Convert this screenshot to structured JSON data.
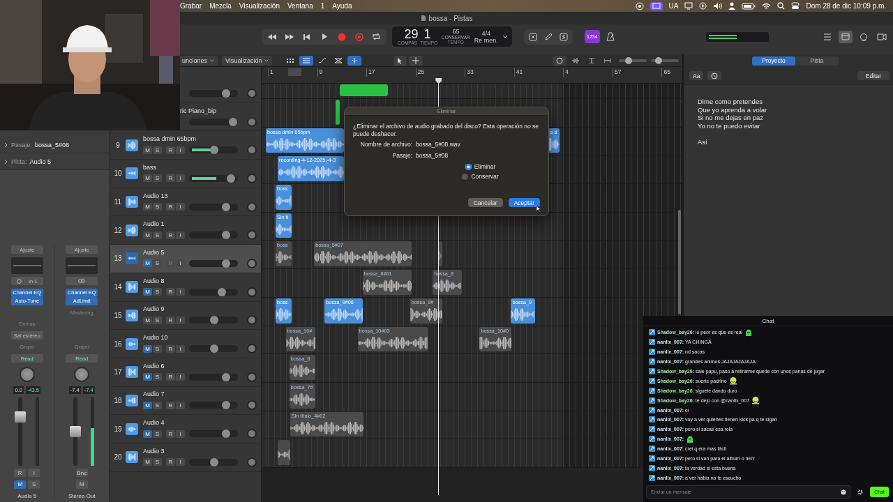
{
  "menu_bar": {
    "items": [
      "Grabar",
      "Mezcla",
      "Visualización",
      "Ventana",
      "1",
      "Ayuda"
    ],
    "input_source": "UA",
    "clock": "Dom 28 de dic 10:09 p.m."
  },
  "window": {
    "title": "bossa - Pistas"
  },
  "control_bar": {
    "bar": "29",
    "beat": "1",
    "bar_label": "COMPÁS",
    "beat_label": "TIEMPO",
    "tempo": "65",
    "tempo_mode": "CONSERVAR",
    "tempo_label": "TEMPO",
    "signature": "4/4",
    "key": "Re men.",
    "count_in": {
      "label": "1234",
      "on": true
    }
  },
  "toolbar": {
    "menus": [
      "unciones",
      "Visualización"
    ],
    "toggles": [
      {
        "kind": "grid",
        "on": false
      },
      {
        "kind": "list",
        "on": true
      },
      {
        "kind": "curve",
        "on": false
      },
      {
        "kind": "flex",
        "on": false
      },
      {
        "kind": "snap",
        "on": true
      }
    ],
    "zoom_sliders": [
      {
        "level": 0.3
      },
      {
        "level": 0.2
      }
    ]
  },
  "inspector": {
    "region": {
      "label": "Pasaje:",
      "value": "bossa_5#08"
    },
    "track": {
      "label": "Pista:",
      "value": "Audio 5"
    },
    "strips": [
      {
        "kind": "audio",
        "name": "Audio 5",
        "setting": "Ajuste",
        "input": "In 1",
        "plugins": [
          "Channel EQ",
          "Auto-Tune"
        ],
        "sends": "Envíos",
        "output": "Sal estéreo",
        "group": "Grupo",
        "automation": "Read",
        "volume": "0.0",
        "peak": "-43.5",
        "fader": {
          "level": 0.75
        },
        "arm": [
          "R",
          "I"
        ],
        "mute": "M",
        "solo": "S",
        "muted": true
      },
      {
        "kind": "output",
        "name": "Stereo Out",
        "setting": "Ajuste",
        "plugins": [
          "Channel EQ",
          "AdLimit"
        ],
        "plugin_set": "Mastering",
        "group": "Grupo",
        "automation": "Read",
        "volume": "-7.4",
        "peak": "-7.4",
        "fader": {
          "level": 0.5
        },
        "meter": {
          "level": 0.55
        },
        "bounce": "Bnc",
        "mute": "M",
        "muted": false
      }
    ]
  },
  "tracks": [
    {
      "level": 0.76,
      "selected": false,
      "regions": [
        {
          "kind": "midi"
        }
      ]
    },
    {
      "name": "ric Piano_bip",
      "level": 0.9,
      "selected": false,
      "regions": [
        {
          "kind": "midi"
        }
      ]
    },
    {
      "number": "9",
      "name": "bossa dmin 65bpm",
      "mute": "M",
      "solo": "S",
      "record": "R",
      "input": "I",
      "muted": false,
      "armed": false,
      "selected": false,
      "level": 0.51,
      "meter": {
        "level": 0.43
      },
      "regions": [
        {
          "kind": "audio",
          "name": "bossa dmin 65bpm",
          "muted": false,
          "selected": false
        },
        {
          "kind": "audio",
          "name": "a d",
          "muted": false,
          "selected": false
        }
      ]
    },
    {
      "number": "10",
      "name": "bass",
      "mute": "M",
      "solo": "S",
      "record": "R",
      "input": "I",
      "muted": false,
      "armed": false,
      "selected": false,
      "level": 0.86,
      "meter": {
        "level": 0.5
      },
      "regions": [
        {
          "kind": "audio",
          "name": "recording-4-12-2025,-4-3",
          "muted": false,
          "selected": false
        }
      ]
    },
    {
      "number": "11",
      "name": "Audio 13",
      "mute": "M",
      "solo": "S",
      "record": "R",
      "input": "I",
      "muted": false,
      "armed": false,
      "selected": false,
      "level": 0.76,
      "regions": [
        {
          "kind": "audio",
          "name": "boss",
          "muted": false,
          "selected": false
        }
      ]
    },
    {
      "number": "12",
      "name": "Audio 1",
      "mute": "M",
      "solo": "S",
      "record": "R",
      "input": "I",
      "muted": false,
      "armed": false,
      "selected": false,
      "level": 0.76,
      "regions": [
        {
          "kind": "audio",
          "name": "Sin tí",
          "muted": false,
          "selected": false
        }
      ]
    },
    {
      "number": "13",
      "name": "Audio 5",
      "mute": "M",
      "solo": "S",
      "record": "R",
      "input": "I",
      "muted": true,
      "armed": true,
      "selected": true,
      "level": 0.76,
      "regions": [
        {
          "kind": "audio",
          "name": "boss",
          "muted": true,
          "selected": false
        },
        {
          "kind": "audio",
          "name": "bossa_5#07",
          "muted": true,
          "selected": false
        },
        {
          "kind": "audio",
          "muted": true,
          "selected": true
        }
      ]
    },
    {
      "number": "14",
      "name": "Audio 8",
      "mute": "M",
      "solo": "S",
      "record": "R",
      "input": "I",
      "muted": true,
      "armed": false,
      "selected": false,
      "level": 0.67,
      "regions": [
        {
          "kind": "audio",
          "name": "bossa_8#01",
          "muted": true,
          "selected": false
        },
        {
          "kind": "audio",
          "name": "bossa_8",
          "muted": true,
          "selected": false
        }
      ]
    },
    {
      "number": "15",
      "name": "Audio 9",
      "mute": "M",
      "solo": "S",
      "record": "R",
      "input": "I",
      "muted": false,
      "armed": false,
      "selected": false,
      "level": 0.51,
      "regions": [
        {
          "kind": "audio",
          "name": "boss",
          "muted": false,
          "selected": false
        },
        {
          "kind": "audio",
          "name": "bossa_9#06",
          "muted": false,
          "selected": false
        },
        {
          "kind": "audio",
          "name": "bossa_9#",
          "muted": true,
          "selected": false
        },
        {
          "kind": "audio",
          "name": "bossa_9",
          "muted": false,
          "selected": false
        }
      ]
    },
    {
      "number": "16",
      "name": "Audio 10",
      "mute": "M",
      "solo": "S",
      "record": "R",
      "input": "I",
      "muted": true,
      "armed": false,
      "selected": false,
      "level": 0.51,
      "regions": [
        {
          "kind": "audio",
          "name": "bossa_10#",
          "muted": true,
          "selected": false
        },
        {
          "kind": "audio",
          "name": "bossa_10#03",
          "muted": true,
          "selected": false
        },
        {
          "kind": "audio",
          "name": "bossa_10#0",
          "muted": true,
          "selected": false
        }
      ]
    },
    {
      "number": "17",
      "name": "Audio 6",
      "mute": "M",
      "solo": "S",
      "record": "R",
      "input": "I",
      "muted": true,
      "armed": false,
      "selected": false,
      "level": 0.76,
      "regions": [
        {
          "kind": "audio",
          "name": "bossa_6",
          "muted": true,
          "selected": false
        }
      ]
    },
    {
      "number": "18",
      "name": "Audio 7",
      "mute": "M",
      "solo": "S",
      "record": "R",
      "input": "I",
      "muted": true,
      "armed": false,
      "selected": false,
      "level": 0.76,
      "regions": [
        {
          "kind": "audio",
          "name": "bossa_7#",
          "muted": true,
          "selected": false
        }
      ]
    },
    {
      "number": "19",
      "name": "Audio 4",
      "mute": "M",
      "solo": "S",
      "record": "R",
      "input": "I",
      "muted": true,
      "armed": false,
      "selected": false,
      "level": 0.76,
      "regions": [
        {
          "kind": "audio",
          "name": "Sin título_4#02",
          "muted": true,
          "selected": false
        }
      ]
    },
    {
      "number": "20",
      "name": "Audio 3",
      "mute": "M",
      "solo": "S",
      "record": "R",
      "input": "I",
      "muted": false,
      "armed": false,
      "selected": false,
      "level": 0.51,
      "regions": [
        {
          "kind": "audio",
          "muted": true,
          "selected": false
        }
      ]
    }
  ],
  "arrange": {
    "ruler": [
      "1",
      "9",
      "17",
      "25",
      "33",
      "41",
      "4",
      "57",
      "65"
    ]
  },
  "dialog": {
    "title": "Eliminar",
    "message": "¿Eliminar el archivo de audio grabado del disco? Esta operación no se puede deshacer.",
    "fields": [
      {
        "label": "Nombre de archivo:",
        "value": "bossa_5#08.wav"
      },
      {
        "label": "Pasaje:",
        "value": "bossa_5#08"
      }
    ],
    "options": [
      {
        "label": "Eliminar",
        "selected": true
      },
      {
        "label": "Conservar",
        "selected": false
      }
    ],
    "buttons": [
      {
        "label": "Cancelar",
        "kind": "secondary"
      },
      {
        "label": "Aceptar",
        "kind": "default"
      }
    ]
  },
  "notes": {
    "tabs": [
      {
        "label": "Proyecto",
        "selected": true
      },
      {
        "label": "Pista",
        "selected": false
      }
    ],
    "font_button": "Aa",
    "edit_button": "Editar",
    "stanzas": [
      [
        "Dime como pretendes",
        "Que yo aprenda a volar",
        "Si no me dejas en paz",
        "Yo no te puedo evitar"
      ],
      [
        "Así"
      ]
    ]
  },
  "chat": {
    "title": "Chat",
    "messages": [
      {
        "user": "Shadow_bay26:",
        "color": "#9fe3a4",
        "text": "lo peor es que es real",
        "emote": {
          "kind": "blob"
        }
      },
      {
        "user": "nanlix_007:",
        "color": "#d4e6f5",
        "text": "YA CHINGA"
      },
      {
        "user": "nanlix_007:",
        "color": "#d4e6f5",
        "text": "nd sacas"
      },
      {
        "user": "nanlix_007:",
        "color": "#d4e6f5",
        "text": "grandes animos JAJAJAJAJAJA"
      },
      {
        "user": "Shadow_bay26:",
        "color": "#9fe3a4",
        "text": "sale papu, paso a retirarme quede con unos panas de jugar"
      },
      {
        "user": "Shadow_bay26:",
        "color": "#9fe3a4",
        "text": "suerte padrino",
        "emote": {
          "kind": "smiley"
        }
      },
      {
        "user": "Shadow_bay26:",
        "color": "#9fe3a4",
        "text": "siguele dando duro"
      },
      {
        "user": "Shadow_bay26:",
        "color": "#9fe3a4",
        "text": "te dejo con @nanlix_007",
        "emote": {
          "kind": "smiley"
        }
      },
      {
        "user": "nanlix_007:",
        "color": "#d4e6f5",
        "text": "ci"
      },
      {
        "user": "nanlix_007:",
        "color": "#d4e6f5",
        "text": "voy a ver quienes tienen kick pa q te sigan"
      },
      {
        "user": "nanlix_007:",
        "color": "#d4e6f5",
        "text": "pero si sacas esa rola"
      },
      {
        "user": "nanlix_007:",
        "color": "#d4e6f5",
        "emote": {
          "kind": "blob"
        }
      },
      {
        "user": "nanlix_007:",
        "color": "#d4e6f5",
        "text": "crei q era mas fácil"
      },
      {
        "user": "nanlix_007:",
        "color": "#d4e6f5",
        "text": "pero si van para el album o nel?"
      },
      {
        "user": "nanlix_007:",
        "color": "#d4e6f5",
        "text": "la verdad si esta buena"
      },
      {
        "user": "nanlix_007:",
        "color": "#d4e6f5",
        "text": "a ver habla no te escucho"
      }
    ],
    "placeholder": "Enviar un mensaje",
    "send_button": "Chat"
  }
}
